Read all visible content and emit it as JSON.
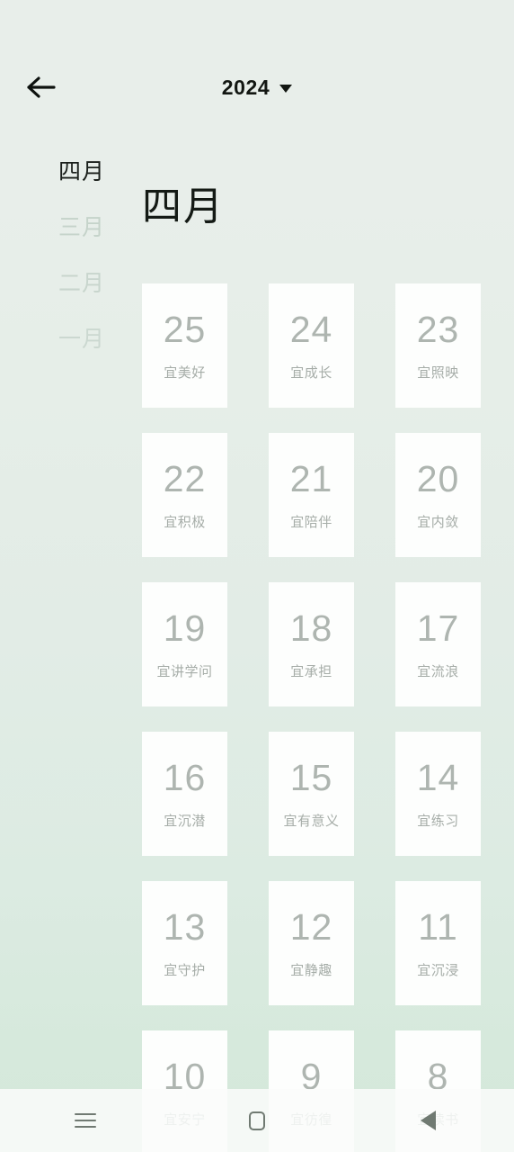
{
  "header": {
    "back_icon": "arrow-left-icon",
    "year": "2024",
    "caret_icon": "chevron-down-icon"
  },
  "month_rail": {
    "items": [
      {
        "label": "四月",
        "active": true
      },
      {
        "label": "三月",
        "active": false
      },
      {
        "label": "二月",
        "active": false
      },
      {
        "label": "一月",
        "active": false
      }
    ]
  },
  "main": {
    "current_month": "四月",
    "days": [
      {
        "num": "25",
        "label": "宜美好"
      },
      {
        "num": "24",
        "label": "宜成长"
      },
      {
        "num": "23",
        "label": "宜照映"
      },
      {
        "num": "22",
        "label": "宜积极"
      },
      {
        "num": "21",
        "label": "宜陪伴"
      },
      {
        "num": "20",
        "label": "宜内敛"
      },
      {
        "num": "19",
        "label": "宜讲学问"
      },
      {
        "num": "18",
        "label": "宜承担"
      },
      {
        "num": "17",
        "label": "宜流浪"
      },
      {
        "num": "16",
        "label": "宜沉潜"
      },
      {
        "num": "15",
        "label": "宜有意义"
      },
      {
        "num": "14",
        "label": "宜练习"
      },
      {
        "num": "13",
        "label": "宜守护"
      },
      {
        "num": "12",
        "label": "宜静趣"
      },
      {
        "num": "11",
        "label": "宜沉浸"
      },
      {
        "num": "10",
        "label": "宜安宁"
      },
      {
        "num": "9",
        "label": "宜彷徨"
      },
      {
        "num": "8",
        "label": "宜读书"
      }
    ]
  },
  "navbar": {
    "recents_icon": "hamburger-icon",
    "home_icon": "square-icon",
    "back_icon": "triangle-back-icon"
  },
  "colors": {
    "background_top": "#e8eeea",
    "background_bottom": "#d4e8da",
    "card_background": "#fdfefd",
    "text_primary": "#141a15",
    "text_muted": "#aeb5b0",
    "month_inactive": "#c5d3ca"
  }
}
